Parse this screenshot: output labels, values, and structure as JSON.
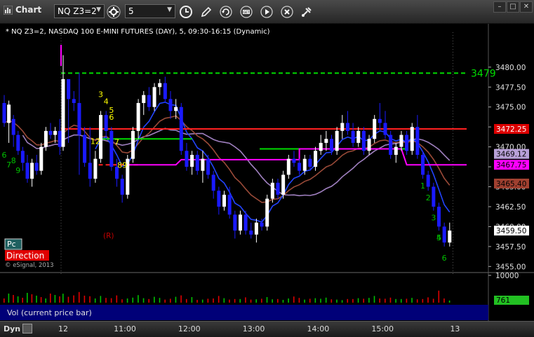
{
  "toolbar": {
    "app_title": "Chart",
    "symbol_value": "NQ Z3=2",
    "interval_value": "5",
    "icons": [
      "link-icon",
      "interval-clock-icon",
      "pencil-draw-icon",
      "refresh-icon",
      "study-icon",
      "play-icon",
      "close-circle-icon",
      "tool-icon"
    ]
  },
  "window_buttons": [
    "minimize",
    "restore",
    "close"
  ],
  "chart_header": "* NQ Z3=2, NASDAQ 100 E-MINI FUTURES (DAY), 5, 09:30-16:15 (Dynamic)",
  "colors": {
    "up_candle": "#ffffff",
    "down_candle": "#1a1aff",
    "red_line": "#ff2020",
    "magenta_line": "#ff00ff",
    "green_line": "#00dd00",
    "lavender_ma": "#a080c0",
    "brown_ma": "#9a4a38",
    "blue_ma": "#2244ff",
    "tdcount_green": "#00c000",
    "tdcount_yellow": "#ffff00"
  },
  "chart_data": {
    "type": "candlestick",
    "y_range": [
      3454.5,
      3483.5
    ],
    "y_ticks": [
      "3480.00",
      "3477.50",
      "3475.00",
      "3472.50",
      "3470.00",
      "3467.50",
      "3465.00",
      "3462.50",
      "3460.00",
      "3457.50",
      "3455.00"
    ],
    "x_ticks": [
      {
        "label": "12",
        "bar": 0
      },
      {
        "label": "11:00",
        "bar": 11.5
      },
      {
        "label": "12:00",
        "bar": 23.5
      },
      {
        "label": "13:00",
        "bar": 35.5
      },
      {
        "label": "14:00",
        "bar": 47.5
      },
      {
        "label": "15:00",
        "bar": 59.5
      },
      {
        "label": "13",
        "bar": 73
      }
    ],
    "prev_day_candles": [
      {
        "o": 3475.5,
        "h": 3476.5,
        "l": 3472.5,
        "c": 3473.0
      },
      {
        "o": 3473.0,
        "h": 3475.8,
        "l": 3470.5,
        "c": 3475.3
      },
      {
        "o": 3473.5,
        "h": 3474.0,
        "l": 3470.0,
        "c": 3471.5
      },
      {
        "o": 3471.5,
        "h": 3472.0,
        "l": 3469.0,
        "c": 3469.5
      },
      {
        "o": 3469.5,
        "h": 3470.0,
        "l": 3467.0,
        "c": 3468.0
      },
      {
        "o": 3468.0,
        "h": 3469.0,
        "l": 3465.5,
        "c": 3466.0
      },
      {
        "o": 3466.0,
        "h": 3468.5,
        "l": 3465.0,
        "c": 3468.0
      },
      {
        "o": 3468.0,
        "h": 3469.0,
        "l": 3466.5,
        "c": 3467.0
      },
      {
        "o": 3467.0,
        "h": 3470.5,
        "l": 3466.5,
        "c": 3470.0
      },
      {
        "o": 3470.0,
        "h": 3472.5,
        "l": 3469.5,
        "c": 3472.0
      },
      {
        "o": 3472.0,
        "h": 3473.0,
        "l": 3471.0,
        "c": 3471.5
      },
      {
        "o": 3471.5,
        "h": 3472.5,
        "l": 3470.5,
        "c": 3472.0
      },
      {
        "o": 3472.0,
        "h": 3473.5,
        "l": 3469.0,
        "c": 3470.0
      }
    ],
    "candles": [
      {
        "o": 3470.0,
        "h": 3481.5,
        "l": 3469.5,
        "c": 3478.5
      },
      {
        "o": 3478.5,
        "h": 3477.5,
        "l": 3470.5,
        "c": 3476.0
      },
      {
        "o": 3476.0,
        "h": 3477.0,
        "l": 3474.5,
        "c": 3475.5
      },
      {
        "o": 3475.5,
        "h": 3479.3,
        "l": 3466.5,
        "c": 3471.5
      },
      {
        "o": 3471.5,
        "h": 3472.5,
        "l": 3467.5,
        "c": 3468.0
      },
      {
        "o": 3468.0,
        "h": 3472.5,
        "l": 3465.0,
        "c": 3466.0
      },
      {
        "o": 3466.0,
        "h": 3469.5,
        "l": 3465.5,
        "c": 3468.5
      },
      {
        "o": 3468.5,
        "h": 3474.5,
        "l": 3468.0,
        "c": 3474.0
      },
      {
        "o": 3474.0,
        "h": 3474.5,
        "l": 3471.0,
        "c": 3472.0
      },
      {
        "o": 3472.0,
        "h": 3472.5,
        "l": 3467.0,
        "c": 3467.5
      },
      {
        "o": 3467.5,
        "h": 3468.5,
        "l": 3465.0,
        "c": 3466.0
      },
      {
        "o": 3466.0,
        "h": 3466.5,
        "l": 3463.0,
        "c": 3464.0
      },
      {
        "o": 3464.0,
        "h": 3469.0,
        "l": 3463.5,
        "c": 3468.5
      },
      {
        "o": 3468.5,
        "h": 3472.5,
        "l": 3468.0,
        "c": 3472.0
      },
      {
        "o": 3472.0,
        "h": 3476.0,
        "l": 3471.0,
        "c": 3475.5
      },
      {
        "o": 3475.5,
        "h": 3477.0,
        "l": 3474.0,
        "c": 3476.5
      },
      {
        "o": 3476.5,
        "h": 3477.5,
        "l": 3474.5,
        "c": 3475.0
      },
      {
        "o": 3475.0,
        "h": 3478.0,
        "l": 3474.5,
        "c": 3477.5
      },
      {
        "o": 3477.5,
        "h": 3478.5,
        "l": 3476.5,
        "c": 3478.0
      },
      {
        "o": 3478.0,
        "h": 3478.8,
        "l": 3475.5,
        "c": 3476.0
      },
      {
        "o": 3476.0,
        "h": 3477.0,
        "l": 3473.5,
        "c": 3474.5
      },
      {
        "o": 3474.5,
        "h": 3476.0,
        "l": 3473.5,
        "c": 3475.0
      },
      {
        "o": 3475.0,
        "h": 3475.5,
        "l": 3469.0,
        "c": 3469.5
      },
      {
        "o": 3469.5,
        "h": 3470.5,
        "l": 3467.0,
        "c": 3467.5
      },
      {
        "o": 3467.5,
        "h": 3469.5,
        "l": 3466.5,
        "c": 3469.0
      },
      {
        "o": 3469.0,
        "h": 3469.5,
        "l": 3466.5,
        "c": 3467.0
      },
      {
        "o": 3467.0,
        "h": 3469.5,
        "l": 3465.5,
        "c": 3468.5
      },
      {
        "o": 3468.5,
        "h": 3469.0,
        "l": 3466.0,
        "c": 3466.5
      },
      {
        "o": 3466.5,
        "h": 3467.0,
        "l": 3463.5,
        "c": 3464.5
      },
      {
        "o": 3464.5,
        "h": 3465.0,
        "l": 3461.5,
        "c": 3462.5
      },
      {
        "o": 3462.5,
        "h": 3464.5,
        "l": 3462.0,
        "c": 3464.0
      },
      {
        "o": 3464.0,
        "h": 3465.0,
        "l": 3461.0,
        "c": 3461.5
      },
      {
        "o": 3461.5,
        "h": 3462.0,
        "l": 3458.5,
        "c": 3459.5
      },
      {
        "o": 3459.5,
        "h": 3462.0,
        "l": 3459.0,
        "c": 3461.5
      },
      {
        "o": 3461.5,
        "h": 3462.0,
        "l": 3459.0,
        "c": 3459.5
      },
      {
        "o": 3459.5,
        "h": 3460.5,
        "l": 3458.5,
        "c": 3459.0
      },
      {
        "o": 3459.0,
        "h": 3461.0,
        "l": 3458.0,
        "c": 3460.5
      },
      {
        "o": 3460.5,
        "h": 3461.0,
        "l": 3459.5,
        "c": 3460.0
      },
      {
        "o": 3460.0,
        "h": 3464.0,
        "l": 3459.5,
        "c": 3463.5
      },
      {
        "o": 3463.5,
        "h": 3466.0,
        "l": 3463.0,
        "c": 3465.5
      },
      {
        "o": 3465.5,
        "h": 3466.0,
        "l": 3463.5,
        "c": 3464.0
      },
      {
        "o": 3464.0,
        "h": 3467.0,
        "l": 3463.5,
        "c": 3466.5
      },
      {
        "o": 3466.5,
        "h": 3469.0,
        "l": 3466.0,
        "c": 3468.5
      },
      {
        "o": 3468.5,
        "h": 3469.5,
        "l": 3467.5,
        "c": 3468.0
      },
      {
        "o": 3468.0,
        "h": 3468.5,
        "l": 3466.5,
        "c": 3467.0
      },
      {
        "o": 3467.0,
        "h": 3469.0,
        "l": 3466.5,
        "c": 3468.5
      },
      {
        "o": 3468.5,
        "h": 3469.0,
        "l": 3467.0,
        "c": 3467.5
      },
      {
        "o": 3467.5,
        "h": 3470.0,
        "l": 3467.0,
        "c": 3469.5
      },
      {
        "o": 3469.5,
        "h": 3471.5,
        "l": 3469.0,
        "c": 3470.5
      },
      {
        "o": 3470.5,
        "h": 3472.0,
        "l": 3469.5,
        "c": 3471.0
      },
      {
        "o": 3471.0,
        "h": 3471.5,
        "l": 3469.0,
        "c": 3469.5
      },
      {
        "o": 3469.5,
        "h": 3472.5,
        "l": 3469.0,
        "c": 3472.0
      },
      {
        "o": 3472.0,
        "h": 3474.0,
        "l": 3471.0,
        "c": 3473.0
      },
      {
        "o": 3473.0,
        "h": 3474.5,
        "l": 3471.5,
        "c": 3472.0
      },
      {
        "o": 3472.0,
        "h": 3473.0,
        "l": 3470.0,
        "c": 3470.5
      },
      {
        "o": 3470.5,
        "h": 3472.5,
        "l": 3470.0,
        "c": 3472.0
      },
      {
        "o": 3472.0,
        "h": 3472.5,
        "l": 3469.0,
        "c": 3469.5
      },
      {
        "o": 3469.5,
        "h": 3471.5,
        "l": 3469.0,
        "c": 3471.0
      },
      {
        "o": 3471.0,
        "h": 3474.0,
        "l": 3470.5,
        "c": 3473.5
      },
      {
        "o": 3473.5,
        "h": 3475.5,
        "l": 3472.0,
        "c": 3473.0
      },
      {
        "o": 3473.0,
        "h": 3474.5,
        "l": 3471.0,
        "c": 3471.5
      },
      {
        "o": 3471.5,
        "h": 3472.0,
        "l": 3468.5,
        "c": 3469.0
      },
      {
        "o": 3469.0,
        "h": 3470.5,
        "l": 3468.0,
        "c": 3470.0
      },
      {
        "o": 3470.0,
        "h": 3472.0,
        "l": 3469.5,
        "c": 3471.5
      },
      {
        "o": 3471.5,
        "h": 3472.0,
        "l": 3469.0,
        "c": 3469.5
      },
      {
        "o": 3469.5,
        "h": 3473.0,
        "l": 3469.0,
        "c": 3472.5
      },
      {
        "o": 3472.5,
        "h": 3474.0,
        "l": 3468.5,
        "c": 3469.0
      },
      {
        "o": 3469.0,
        "h": 3469.5,
        "l": 3466.0,
        "c": 3466.5
      },
      {
        "o": 3466.5,
        "h": 3467.0,
        "l": 3464.5,
        "c": 3465.0
      },
      {
        "o": 3465.0,
        "h": 3465.5,
        "l": 3462.0,
        "c": 3462.5
      },
      {
        "o": 3462.5,
        "h": 3463.0,
        "l": 3459.5,
        "c": 3460.0
      },
      {
        "o": 3460.0,
        "h": 3460.5,
        "l": 3457.5,
        "c": 3458.0
      },
      {
        "o": 3458.0,
        "h": 3460.5,
        "l": 3457.5,
        "c": 3459.5
      }
    ],
    "volume": [
      3200,
      2100,
      2600,
      3800,
      2500,
      2300,
      1500,
      2400,
      1700,
      1600,
      2600,
      1200,
      1500,
      1800,
      2700,
      1600,
      1300,
      2100,
      1700,
      1100,
      1400,
      2100,
      2600,
      1300,
      2000,
      1000,
      1100,
      1400,
      1500,
      2400,
      1600,
      1100,
      1300,
      1300,
      1900,
      1100,
      1200,
      1400,
      2000,
      1200,
      1300,
      1000,
      1500,
      2200,
      1700,
      1100,
      1400,
      1600,
      1400,
      1800,
      1200,
      1100,
      900,
      1300,
      1300,
      1600,
      1400,
      1700,
      2400,
      1500,
      1400,
      1800,
      1300,
      1300,
      1400,
      1700,
      1200,
      1300,
      1900,
      1400,
      4300,
      1500,
      761
    ],
    "volume_axis": {
      "max_label": "10000",
      "current_label": "761"
    },
    "horizontal_lines": [
      {
        "price": 3479.25,
        "label": "3479",
        "color": "#00dd00",
        "style": "dashed",
        "from_bar": 0
      },
      {
        "price": 3472.25,
        "color": "#ff2020",
        "style": "solid",
        "from_bar": 0
      },
      {
        "price": 3471.0,
        "color": "#00dd00",
        "style": "solid",
        "from_bar": 7,
        "to_bar": 24
      },
      {
        "price": 3467.75,
        "color": "#ff2020",
        "style": "dashed",
        "from_bar": 7,
        "to_bar": 14
      },
      {
        "price": 3469.75,
        "color": "#00dd00",
        "style": "solid",
        "from_bar": 37,
        "to_bar": 64
      }
    ],
    "price_badges": [
      {
        "price": 3472.25,
        "label": "3472.25",
        "bg": "#dd0000",
        "fg": "#ffffff"
      },
      {
        "price": 3469.12,
        "label": "3469.12",
        "bg": "#b8a0d8",
        "fg": "#000000"
      },
      {
        "price": 3467.75,
        "label": "3467.75",
        "bg": "#ff00ff",
        "fg": "#000000"
      },
      {
        "price": 3465.4,
        "label": "3465.40",
        "bg": "#a04030",
        "fg": "#000000"
      },
      {
        "price": 3459.5,
        "label": "3459.50",
        "bg": "#ffffff",
        "fg": "#000000"
      }
    ],
    "td_counts_prev": [
      {
        "bar": 0,
        "text": "6"
      },
      {
        "bar": 1,
        "text": "7"
      },
      {
        "bar": 2,
        "text": "8"
      },
      {
        "bar": 3,
        "text": "9"
      }
    ],
    "td_counts": [
      {
        "bar": 6,
        "text": "12",
        "color": "#ffff00"
      },
      {
        "bar": 7,
        "text": "3",
        "color": "#ffff00"
      },
      {
        "bar": 8,
        "text": "4",
        "color": "#ffff00"
      },
      {
        "bar": 9,
        "text": "5",
        "color": "#ffff00"
      },
      {
        "bar": 9,
        "text": "6",
        "color": "#ffff00"
      },
      {
        "bar": 10,
        "text": "7",
        "color": "#ffff00"
      },
      {
        "bar": 11,
        "text": "89",
        "color": "#ffff00"
      },
      {
        "bar": 67,
        "text": "1",
        "color": "#00c000"
      },
      {
        "bar": 68,
        "text": "2",
        "color": "#00c000"
      },
      {
        "bar": 69,
        "text": "3",
        "color": "#00c000"
      },
      {
        "bar": 70,
        "text": "4",
        "color": "#00c000"
      },
      {
        "bar": 70,
        "text": "5",
        "color": "#00c000"
      },
      {
        "bar": 71,
        "text": "6",
        "color": "#00c000"
      }
    ],
    "annotations": {
      "r_marker": "(R)",
      "pc_label": "Pc",
      "direction_label": "Direction",
      "copyright": "© eSignal, 2013"
    }
  },
  "volume_panel_label": "Vol (current price bar)",
  "bottom_bar": {
    "dyn_label": "Dyn"
  }
}
